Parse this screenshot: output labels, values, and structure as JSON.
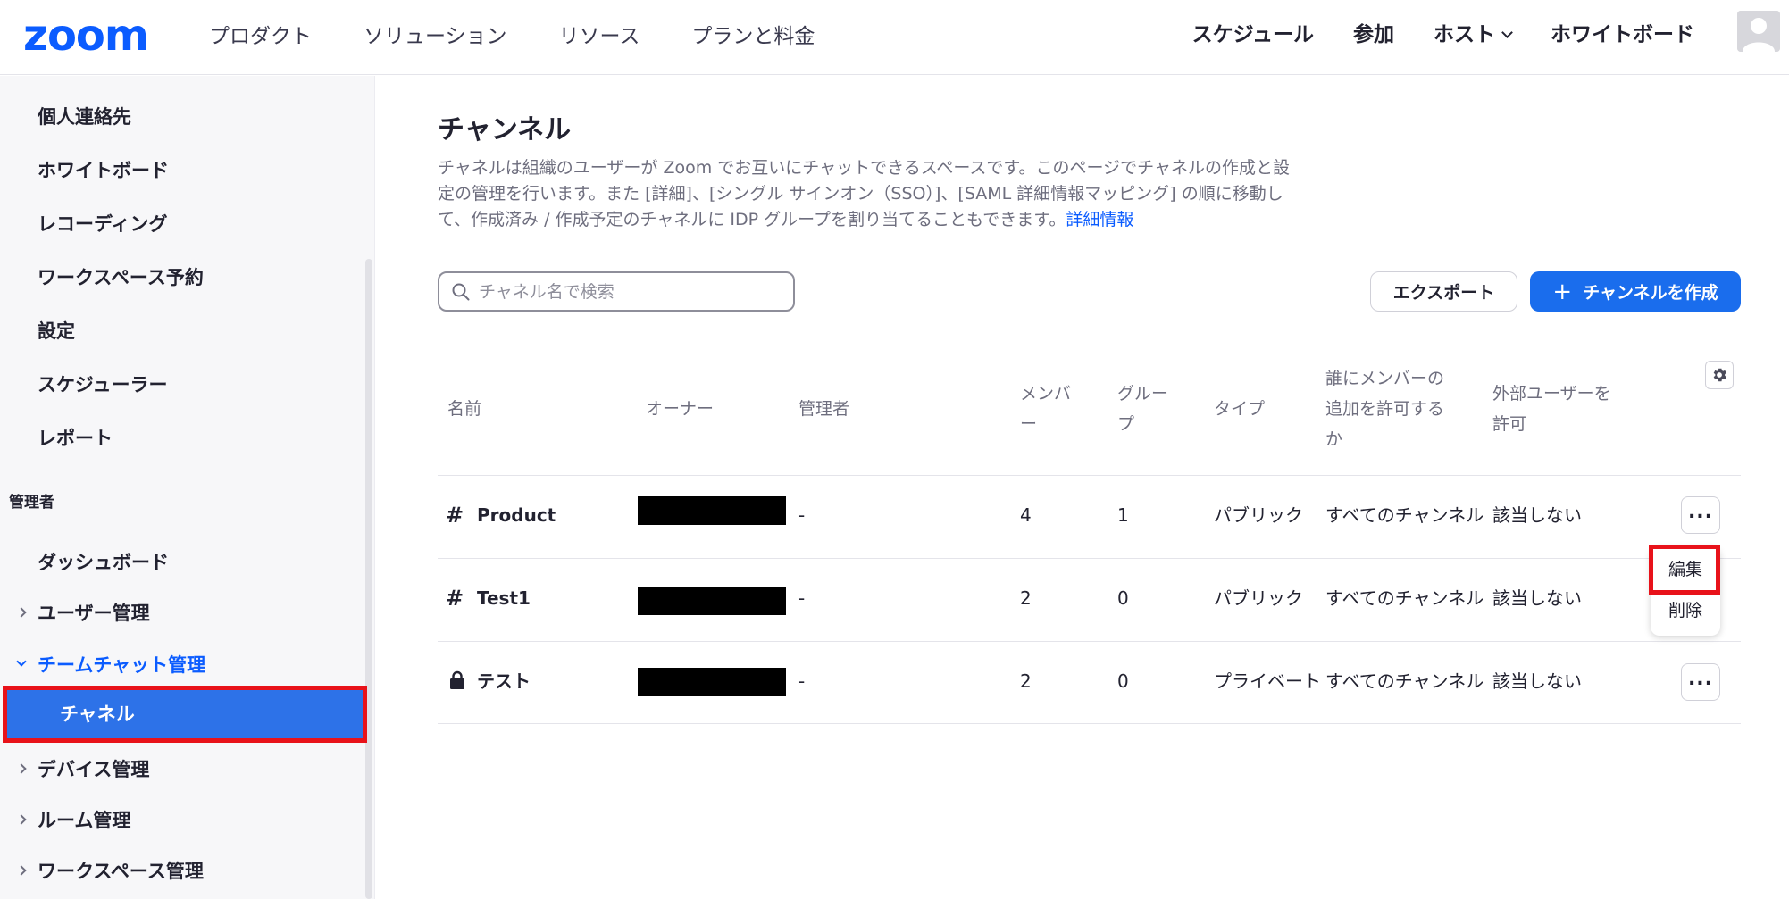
{
  "topnav": {
    "logo": "zoom",
    "left": [
      "プロダクト",
      "ソリューション",
      "リソース",
      "プランと料金"
    ],
    "right": [
      "スケジュール",
      "参加",
      "ホスト",
      "ホワイトボード"
    ]
  },
  "sidebar": {
    "items_top": [
      "個人連絡先",
      "ホワイトボード",
      "レコーディング",
      "ワークスペース予約",
      "設定",
      "スケジューラー",
      "レポート"
    ],
    "section_admin": "管理者",
    "dashboard": "ダッシュボード",
    "user_mgmt": "ユーザー管理",
    "team_chat_mgmt": "チームチャット管理",
    "channel": "チャネル",
    "device_mgmt": "デバイス管理",
    "room_mgmt": "ルーム管理",
    "workspace_mgmt": "ワークスペース管理"
  },
  "main": {
    "title": "チャンネル",
    "desc_line1": "チャネルは組織のユーザーが Zoom でお互いにチャットできるスペースです。このページでチャネルの作成と設",
    "desc_line2": "定の管理を行います。また [詳細]、[シングル サインオン（SSO）]、[SAML 詳細情報マッピング] の順に移動し",
    "desc_line3": "て、作成済み / 作成予定のチャネルに IDP グループを割り当てることもできます。",
    "desc_link": "詳細情報",
    "search_placeholder": "チャネル名で検索",
    "export_label": "エクスポート",
    "create_label": "チャンネルを作成",
    "create_plus": "+"
  },
  "table": {
    "headers": {
      "name": "名前",
      "owner": "オーナー",
      "admin": "管理者",
      "members_1": "メンバ",
      "members_2": "ー",
      "groups_1": "グルー",
      "groups_2": "プ",
      "type": "タイプ",
      "who_1": "誰にメンバーの",
      "who_2": "追加を許可する",
      "who_3": "か",
      "ext_1": "外部ユーザーを",
      "ext_2": "許可"
    },
    "rows": [
      {
        "name": "Product",
        "admin": "-",
        "members": "4",
        "groups": "1",
        "type": "パブリック",
        "who": "すべてのチャンネル",
        "external": "該当しない"
      },
      {
        "name": "Test1",
        "admin": "-",
        "members": "2",
        "groups": "0",
        "type": "パブリック",
        "who": "すべてのチャンネル",
        "external": "該当しない"
      },
      {
        "name": "テスト",
        "admin": "-",
        "members": "2",
        "groups": "0",
        "type": "プライベート",
        "who": "すべてのチャンネル",
        "external": "該当しない"
      }
    ],
    "more_label": "...",
    "hash": "#"
  },
  "menu": {
    "edit": "編集",
    "delete": "削除"
  },
  "colors": {
    "brand": "#0b5cff",
    "primary_button": "#1a6ded",
    "selected_sidebar": "#2d72e8",
    "highlight": "#e8121a"
  }
}
